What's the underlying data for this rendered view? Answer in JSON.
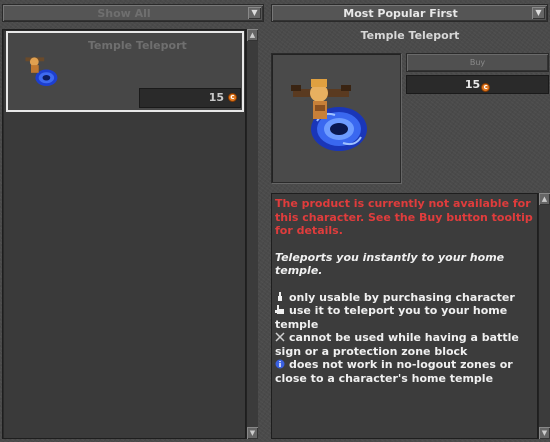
{
  "filters": {
    "category": "Show All",
    "sort": "Most Popular First"
  },
  "product_list": [
    {
      "name": "Temple Teleport",
      "price": "15"
    }
  ],
  "detail": {
    "title": "Temple Teleport",
    "buy_label": "Buy",
    "price": "15",
    "warning": "The product is currently not available for this character. See the Buy button tooltip for details.",
    "description": "Teleports you instantly to your home temple.",
    "features": [
      {
        "icon": "pointing-hand-icon",
        "text": "only usable by purchasing character"
      },
      {
        "icon": "hand-icon",
        "text": "use it to teleport you to your home temple"
      },
      {
        "icon": "crossed-swords-icon",
        "text": "cannot be used while having a battle sign or a protection zone block"
      },
      {
        "icon": "info-icon",
        "text": "does not work in no-logout zones or close to a character's home temple"
      }
    ]
  },
  "colors": {
    "warning": "#e03c3c",
    "coin": "#e07820",
    "selected_border": "#e8e8e8"
  }
}
